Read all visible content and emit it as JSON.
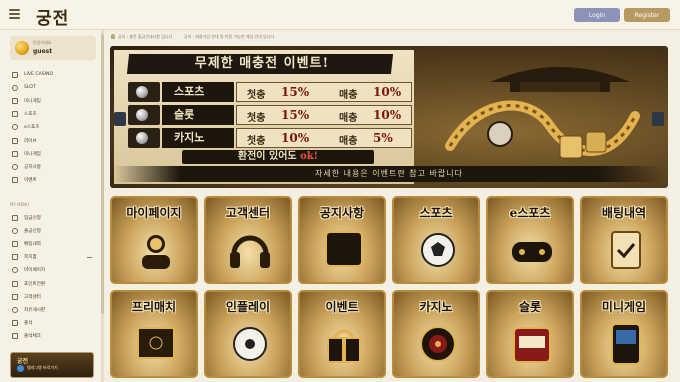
{
  "header": {
    "logo_text": "궁전",
    "login_label": "Login",
    "register_label": "Register"
  },
  "sidebar": {
    "user": {
      "label": "안녕하세요",
      "name": "guest"
    },
    "items": [
      {
        "label": "LIVE CASINO",
        "icon": "casino-chip-icon"
      },
      {
        "label": "SLOT",
        "icon": "slot-machine-icon"
      },
      {
        "label": "미니게임",
        "icon": "dice-icon"
      },
      {
        "label": "스포츠",
        "icon": "ball-icon"
      },
      {
        "label": "e스포츠",
        "icon": "gamepad-icon"
      },
      {
        "label": "라이브",
        "icon": "tv-icon"
      },
      {
        "label": "미니게임",
        "icon": "cards-icon"
      },
      {
        "label": "공지사항",
        "icon": "notice-icon"
      },
      {
        "label": "이벤트",
        "icon": "gift-icon"
      }
    ],
    "section_label": "MY MENU",
    "my_items": [
      {
        "label": "입금신청",
        "icon": "deposit-icon"
      },
      {
        "label": "출금신청",
        "icon": "withdraw-icon"
      },
      {
        "label": "배팅내역",
        "icon": "history-icon"
      },
      {
        "label": "쪽지함",
        "icon": "message-icon"
      },
      {
        "label": "마이페이지",
        "icon": "user-icon"
      },
      {
        "label": "포인트전환",
        "icon": "point-icon"
      },
      {
        "label": "고객센터",
        "icon": "support-icon"
      },
      {
        "label": "자유게시판",
        "icon": "board-icon"
      },
      {
        "label": "출석",
        "icon": "calendar-icon"
      },
      {
        "label": "출석체크",
        "icon": "check-icon"
      }
    ],
    "telegram": {
      "logo": "궁전",
      "text": "텔레그램 바로가기"
    }
  },
  "notice": {
    "item1": "공지 : 충전 출금안내사항 입니다",
    "item2": "공지 : 회원가입 안내 및 이용 가능한 게임 안내 입니다"
  },
  "banner": {
    "title": "무제한 매충전 이벤트!",
    "rows": [
      {
        "category": "스포츠",
        "first_label": "첫충",
        "first_value": "15%",
        "each_label": "매충",
        "each_value": "10%"
      },
      {
        "category": "슬롯",
        "first_label": "첫충",
        "first_value": "15%",
        "each_label": "매충",
        "each_value": "10%"
      },
      {
        "category": "카지노",
        "first_label": "첫충",
        "first_value": "10%",
        "each_label": "매충",
        "each_value": "5%"
      }
    ],
    "refund_text": "환전이 있어도",
    "refund_ok": "ok!",
    "detail_text": "자세한 내용은 이벤트란 참고 바랍니다"
  },
  "tiles": [
    {
      "label": "마이페이지",
      "icon": "user-icon"
    },
    {
      "label": "고객센터",
      "icon": "headset-icon"
    },
    {
      "label": "공지사항",
      "icon": "board-icon"
    },
    {
      "label": "스포츠",
      "icon": "soccer-ball-icon"
    },
    {
      "label": "e스포츠",
      "icon": "gamepad-icon"
    },
    {
      "label": "배팅내역",
      "icon": "scroll-icon"
    },
    {
      "label": "프리매치",
      "icon": "tactics-board-icon"
    },
    {
      "label": "인플레이",
      "icon": "ball-icon"
    },
    {
      "label": "이벤트",
      "icon": "gift-icon"
    },
    {
      "label": "카지노",
      "icon": "roulette-icon"
    },
    {
      "label": "슬롯",
      "icon": "slot-machine-icon"
    },
    {
      "label": "미니게임",
      "icon": "arcade-icon"
    }
  ],
  "colors": {
    "gold": "#b88b3a",
    "dark_brown": "#1d160d",
    "accent_red": "#7a1414",
    "login_btn": "#8d93b8",
    "register_btn": "#b79a62"
  }
}
